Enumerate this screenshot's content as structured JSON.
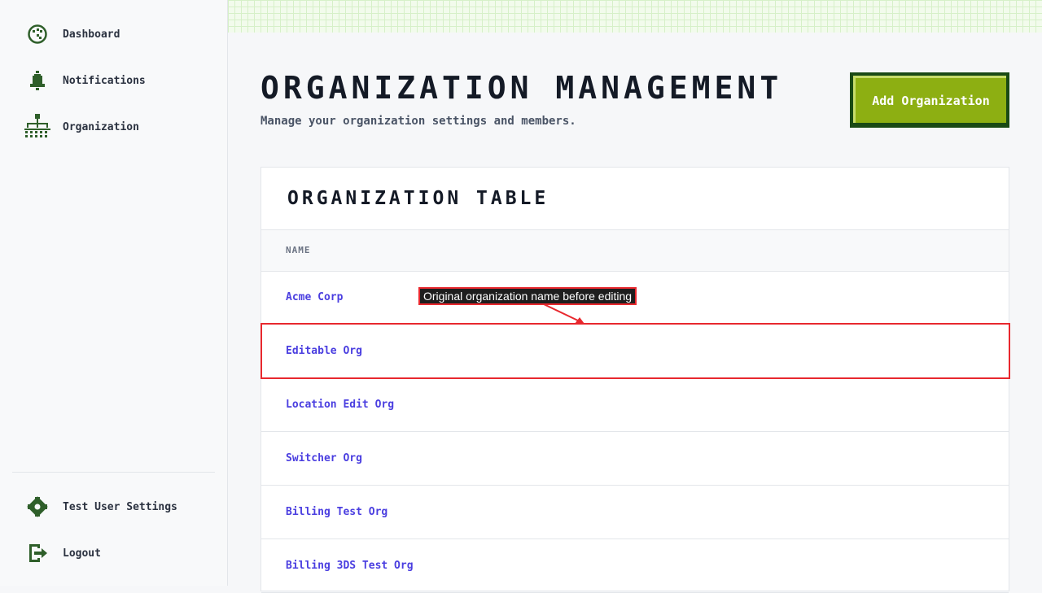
{
  "sidebar": {
    "items": [
      {
        "label": "Dashboard",
        "icon": "dashboard-icon"
      },
      {
        "label": "Notifications",
        "icon": "bell-icon"
      },
      {
        "label": "Organization",
        "icon": "org-chart-icon"
      }
    ],
    "bottom_items": [
      {
        "label": "Test User Settings",
        "icon": "gear-icon"
      },
      {
        "label": "Logout",
        "icon": "logout-icon"
      }
    ]
  },
  "header": {
    "title": "ORGANIZATION MANAGEMENT",
    "subtitle": "Manage your organization settings and members.",
    "add_button_label": "Add Organization"
  },
  "table": {
    "title": "ORGANIZATION TABLE",
    "columns": [
      "NAME"
    ],
    "rows": [
      "Acme Corp",
      "Editable Org",
      "Location Edit Org",
      "Switcher Org",
      "Billing Test Org",
      "Billing 3DS Test Org"
    ]
  },
  "annotation": {
    "text": "Original organization name before editing"
  },
  "colors": {
    "accent_green": "#8daf12",
    "icon_green": "#2f5f2a",
    "link_blue": "#4a3ee0",
    "annotation_red": "#e8282e"
  }
}
